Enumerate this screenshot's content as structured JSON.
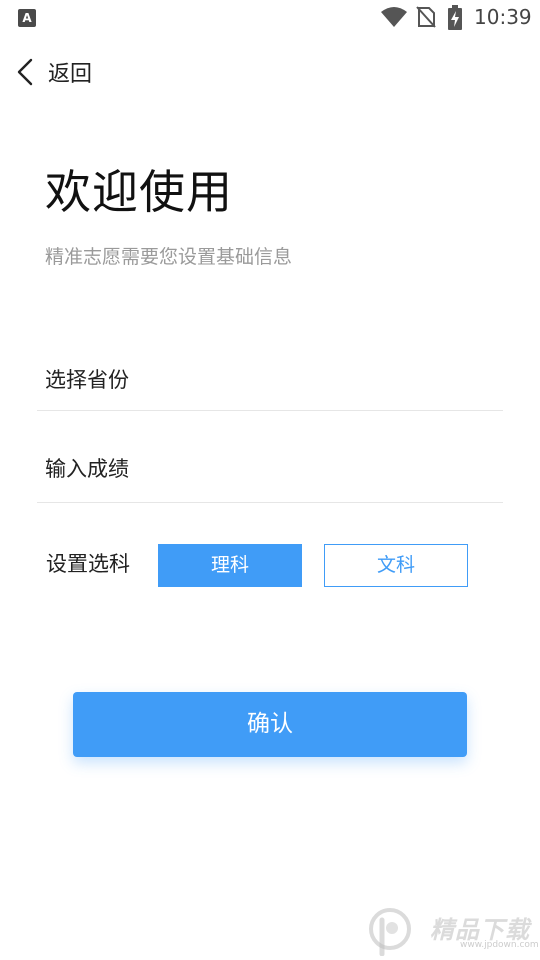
{
  "status_bar": {
    "app_icon": "A",
    "time": "10:39",
    "icons": [
      "wifi-icon",
      "no-sim-icon",
      "battery-charging-icon"
    ]
  },
  "header": {
    "back_label": "返回"
  },
  "page": {
    "title": "欢迎使用",
    "subtitle": "精准志愿需要您设置基础信息"
  },
  "form": {
    "province_label": "选择省份",
    "score_label": "输入成绩",
    "subject_label": "设置选科",
    "subject_options": [
      {
        "label": "理科",
        "selected": true
      },
      {
        "label": "文科",
        "selected": false
      }
    ]
  },
  "actions": {
    "confirm_label": "确认"
  },
  "watermark": {
    "text": "精品下载",
    "sub": "www.jpdown.com"
  },
  "colors": {
    "accent": "#409cf7",
    "text": "#222222",
    "subtle": "#9a9a9a",
    "divider": "#e6e6e6"
  }
}
